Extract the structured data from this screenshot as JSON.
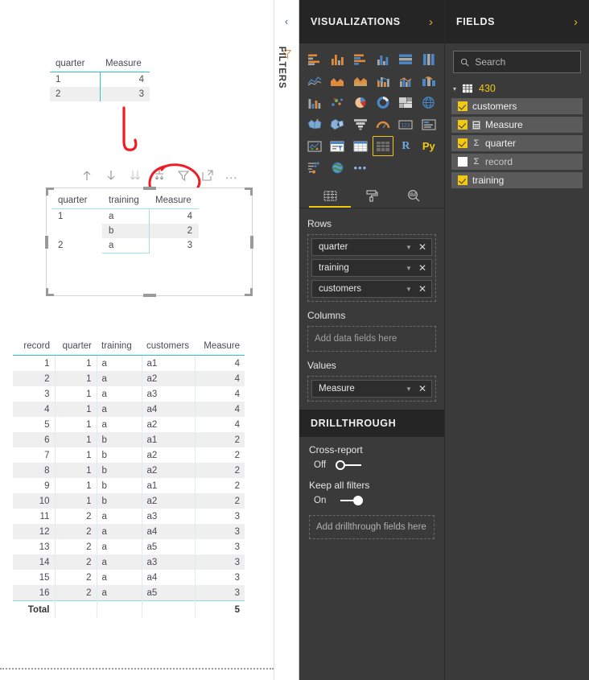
{
  "canvas": {
    "summary_table": {
      "name": "quarter-measure-summary-table",
      "headers": [
        "quarter",
        "Measure"
      ],
      "rows": [
        {
          "quarter": "1",
          "measure": "4"
        },
        {
          "quarter": "2",
          "measure": "3"
        }
      ]
    },
    "matrix_visual": {
      "name": "matrix-visual",
      "headers": [
        "quarter",
        "training",
        "Measure"
      ],
      "rows": [
        {
          "quarter": "1",
          "training": "a",
          "measure": "4"
        },
        {
          "quarter": "",
          "training": "b",
          "measure": "2"
        },
        {
          "quarter": "2",
          "training": "a",
          "measure": "3"
        }
      ],
      "toolbar": {
        "drill_up": "drill-up",
        "drill_down": "drill-down",
        "go_to_next_level": "go-to-next-level",
        "expand_all": "expand-all-down-one-level",
        "filters": "filters",
        "focus_mode": "focus-mode",
        "more_options": "..."
      }
    },
    "detail_table": {
      "name": "detail-data-table",
      "headers": [
        "record",
        "quarter",
        "training",
        "customers",
        "Measure"
      ],
      "rows": [
        {
          "record": "1",
          "quarter": "1",
          "training": "a",
          "customers": "a1",
          "measure": "4"
        },
        {
          "record": "2",
          "quarter": "1",
          "training": "a",
          "customers": "a2",
          "measure": "4"
        },
        {
          "record": "3",
          "quarter": "1",
          "training": "a",
          "customers": "a3",
          "measure": "4"
        },
        {
          "record": "4",
          "quarter": "1",
          "training": "a",
          "customers": "a4",
          "measure": "4"
        },
        {
          "record": "5",
          "quarter": "1",
          "training": "a",
          "customers": "a2",
          "measure": "4"
        },
        {
          "record": "6",
          "quarter": "1",
          "training": "b",
          "customers": "a1",
          "measure": "2"
        },
        {
          "record": "7",
          "quarter": "1",
          "training": "b",
          "customers": "a2",
          "measure": "2"
        },
        {
          "record": "8",
          "quarter": "1",
          "training": "b",
          "customers": "a2",
          "measure": "2"
        },
        {
          "record": "9",
          "quarter": "1",
          "training": "b",
          "customers": "a1",
          "measure": "2"
        },
        {
          "record": "10",
          "quarter": "1",
          "training": "b",
          "customers": "a2",
          "measure": "2"
        },
        {
          "record": "11",
          "quarter": "2",
          "training": "a",
          "customers": "a3",
          "measure": "3"
        },
        {
          "record": "12",
          "quarter": "2",
          "training": "a",
          "customers": "a4",
          "measure": "3"
        },
        {
          "record": "13",
          "quarter": "2",
          "training": "a",
          "customers": "a5",
          "measure": "3"
        },
        {
          "record": "14",
          "quarter": "2",
          "training": "a",
          "customers": "a3",
          "measure": "3"
        },
        {
          "record": "15",
          "quarter": "2",
          "training": "a",
          "customers": "a4",
          "measure": "3"
        },
        {
          "record": "16",
          "quarter": "2",
          "training": "a",
          "customers": "a5",
          "measure": "3"
        }
      ],
      "total": {
        "label": "Total",
        "measure": "5"
      }
    },
    "annotations": {
      "arrow": "red-hand-drawn-down-arrow",
      "circle": "red-hand-drawn-circle-around-expand-all-icon"
    }
  },
  "filters_rail": {
    "label": "FILTERS",
    "chevron": "‹",
    "icon": "filter-funnel-icon"
  },
  "visualizations": {
    "title": "VISUALIZATIONS",
    "expand_chevron": "›",
    "icons": [
      "stacked-bar-chart",
      "stacked-column-chart",
      "clustered-bar-chart",
      "clustered-column-chart",
      "100-percent-stacked-bar-chart",
      "100-percent-stacked-column-chart",
      "line-chart",
      "area-chart",
      "stacked-area-chart",
      "line-and-stacked-column-chart",
      "line-and-clustered-column-chart",
      "ribbon-chart",
      "waterfall-chart",
      "scatter-chart",
      "pie-chart",
      "donut-chart",
      "treemap",
      "map",
      "filled-map",
      "shape-map",
      "funnel",
      "gauge",
      "card",
      "multi-row-card",
      "kpi",
      "slicer",
      "table",
      "matrix",
      "r-script-visual",
      "python-visual",
      "key-influencers",
      "arcgis-map",
      "more-visuals"
    ],
    "selected_icon": "matrix",
    "r_label": "R",
    "py_label": "Py",
    "more_dots": "•••",
    "tabs": [
      {
        "name": "fields-tab",
        "icon": "fields-grid-icon",
        "active": true
      },
      {
        "name": "format-tab",
        "icon": "paint-roller-icon",
        "active": false
      },
      {
        "name": "analytics-tab",
        "icon": "magnifier-chart-icon",
        "active": false
      }
    ],
    "wells": [
      {
        "title": "Rows",
        "name": "rows-well",
        "fields": [
          "quarter",
          "training",
          "customers"
        ],
        "placeholder": null
      },
      {
        "title": "Columns",
        "name": "columns-well",
        "fields": [],
        "placeholder": "Add data fields here"
      },
      {
        "title": "Values",
        "name": "values-well",
        "fields": [
          "Measure"
        ],
        "placeholder": null
      }
    ],
    "drillthrough": {
      "title": "DRILLTHROUGH",
      "cross_report": {
        "label": "Cross-report",
        "state": "Off",
        "on": false
      },
      "keep_all_filters": {
        "label": "Keep all filters",
        "state": "On",
        "on": true
      },
      "drop_placeholder": "Add drillthrough fields here"
    }
  },
  "fields": {
    "title": "FIELDS",
    "expand_chevron": "›",
    "search_placeholder": "Search",
    "search_value": "",
    "table_name": "430",
    "items": [
      {
        "label": "customers",
        "checked": true,
        "aggregate": ""
      },
      {
        "label": "Measure",
        "checked": true,
        "aggregate": "measure-icon"
      },
      {
        "label": "quarter",
        "checked": true,
        "aggregate": "Σ"
      },
      {
        "label": "record",
        "checked": false,
        "aggregate": "Σ"
      },
      {
        "label": "training",
        "checked": true,
        "aggregate": ""
      }
    ]
  },
  "colors": {
    "accent_teal": "#2fc4c4",
    "pbi_yellow": "#f2c811",
    "pane_bg": "#3a3a3a",
    "pane_header_bg": "#252525",
    "annotation_red": "#ee1c25"
  }
}
